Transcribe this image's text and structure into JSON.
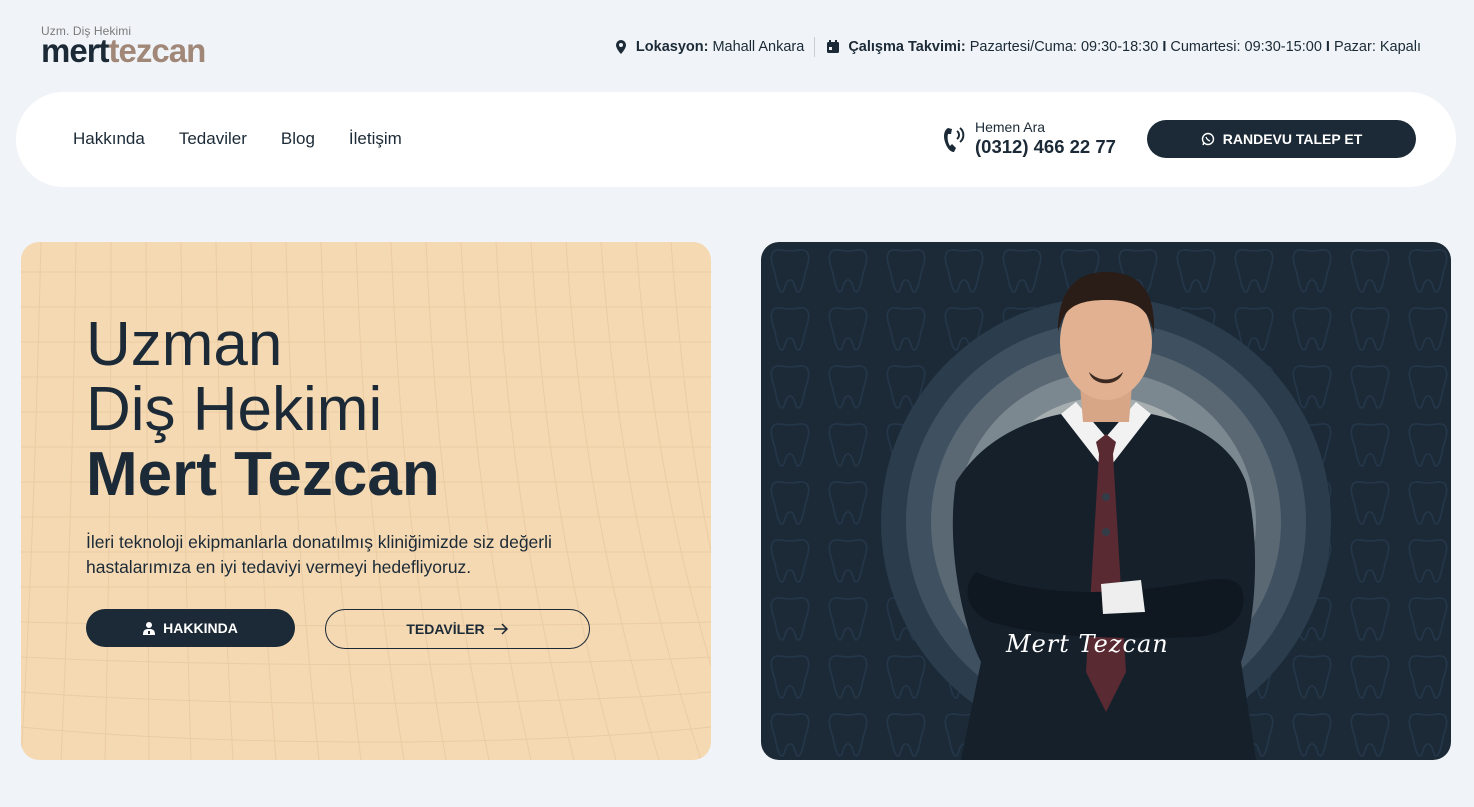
{
  "brand": {
    "subtitle": "Uzm. Diş Hekimi",
    "name_part1": "mert",
    "name_part2": "tezcan"
  },
  "topbar": {
    "location_label": "Lokasyon:",
    "location_value": "Mahall Ankara",
    "schedule_label": "Çalışma Takvimi:",
    "schedule_weekday": "Pazartesi/Cuma: 09:30-18:30",
    "schedule_saturday": "Cumartesi: 09:30-15:00",
    "schedule_sunday": "Pazar: Kapalı",
    "separator": "I"
  },
  "nav": {
    "items": [
      {
        "label": "Hakkında"
      },
      {
        "label": "Tedaviler"
      },
      {
        "label": "Blog"
      },
      {
        "label": "İletişim"
      }
    ],
    "phone_label": "Hemen Ara",
    "phone_number": "(0312) 466 22 77",
    "cta_label": "RANDEVU TALEP ET"
  },
  "hero": {
    "title_line1": "Uzman",
    "title_line2": "Diş Hekimi",
    "title_line3": "Mert Tezcan",
    "lead": "İleri teknoloji ekipmanlarla donatılmış kliniğimizde siz değerli hastalarımıza en iyi tedaviyi vermeyi hedefliyoruz.",
    "primary_button": "HAKKINDA",
    "secondary_button": "TEDAVİLER",
    "signature": "Mert Tezcan"
  },
  "colors": {
    "navy": "#1b2a36",
    "peach": "#f5d9b3",
    "brand_brown": "#a08778",
    "page_bg": "#f0f4f8"
  }
}
